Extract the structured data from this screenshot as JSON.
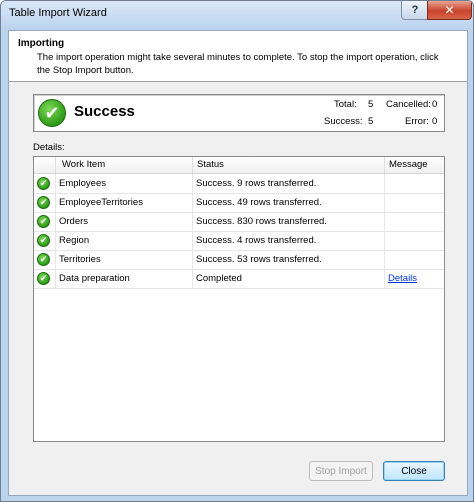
{
  "window": {
    "title": "Table Import Wizard",
    "help_glyph": "?",
    "close_glyph": "✕"
  },
  "header": {
    "title": "Importing",
    "description": "The import operation might take several minutes to complete. To stop the import operation, click the Stop Import button."
  },
  "summary": {
    "status": "Success",
    "total_label": "Total:",
    "total_value": "5",
    "cancelled_label": "Cancelled:",
    "cancelled_value": "0",
    "success_label": "Success:",
    "success_value": "5",
    "error_label": "Error:",
    "error_value": "0"
  },
  "details": {
    "label": "Details:",
    "columns": [
      "Work Item",
      "Status",
      "Message"
    ],
    "rows": [
      {
        "work_item": "Employees",
        "status": "Success. 9 rows transferred.",
        "message": ""
      },
      {
        "work_item": "EmployeeTerritories",
        "status": "Success. 49 rows transferred.",
        "message": ""
      },
      {
        "work_item": "Orders",
        "status": "Success. 830 rows transferred.",
        "message": ""
      },
      {
        "work_item": "Region",
        "status": "Success. 4 rows transferred.",
        "message": ""
      },
      {
        "work_item": "Territories",
        "status": "Success. 53 rows transferred.",
        "message": ""
      },
      {
        "work_item": "Data preparation",
        "status": "Completed",
        "message": "Details"
      }
    ]
  },
  "footer": {
    "stop_import_label": "Stop Import",
    "close_label": "Close"
  },
  "icons": {
    "success": "check-circle-icon"
  },
  "colors": {
    "success_green": "#2f9a1a",
    "link_blue": "#0033cc"
  }
}
